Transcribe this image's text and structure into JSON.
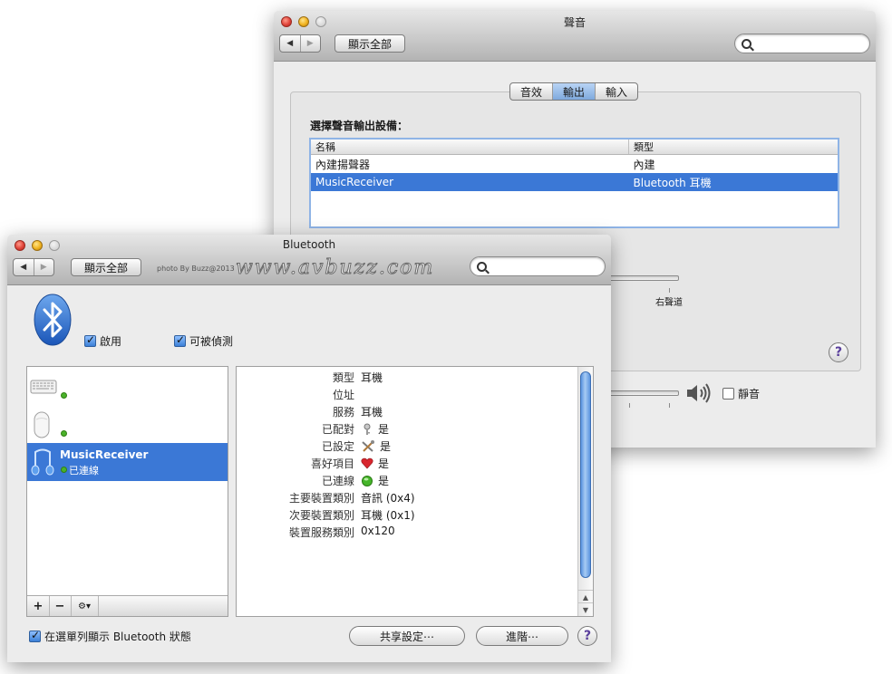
{
  "sound": {
    "title": "聲音",
    "nav_back": "◀",
    "nav_forward": "▶",
    "show_all": "顯示全部",
    "search_placeholder": "",
    "tabs": [
      {
        "label": "音效",
        "selected": false
      },
      {
        "label": "輸出",
        "selected": true
      },
      {
        "label": "輸入",
        "selected": false
      }
    ],
    "choose_label": "選擇聲音輸出設備：",
    "columns": {
      "name": "名稱",
      "type": "類型"
    },
    "devices": [
      {
        "name": "內建揚聲器",
        "type": "內建",
        "selected": false
      },
      {
        "name": "MusicReceiver",
        "type": "Bluetooth 耳機",
        "selected": true
      }
    ],
    "balance_right_label": "右聲道",
    "help": "?",
    "mute_label": "靜音"
  },
  "bluetooth": {
    "title": "Bluetooth",
    "nav_back": "◀",
    "nav_forward": "▶",
    "show_all": "顯示全部",
    "credit": "photo By Buzz@2013",
    "watermark": "www.avbuzz.com",
    "search_placeholder": "",
    "enable_label": "啟用",
    "discoverable_label": "可被偵測",
    "devices": [
      {
        "icon": "keyboard-icon",
        "name": "",
        "status": "",
        "selected": false
      },
      {
        "icon": "mouse-icon",
        "name": "",
        "status": "",
        "selected": false
      },
      {
        "icon": "headphones-icon",
        "name": "MusicReceiver",
        "status": "已連線",
        "selected": true
      }
    ],
    "list_buttons": {
      "add": "+",
      "remove": "−",
      "action": "⚙▾"
    },
    "details": [
      {
        "label": "類型",
        "value": "耳機",
        "icon": ""
      },
      {
        "label": "位址",
        "value": "",
        "icon": ""
      },
      {
        "label": "服務",
        "value": "耳機",
        "icon": ""
      },
      {
        "label": "已配對",
        "value": "是",
        "icon": "key-icon"
      },
      {
        "label": "已設定",
        "value": "是",
        "icon": "tools-icon"
      },
      {
        "label": "喜好項目",
        "value": "是",
        "icon": "heart-icon"
      },
      {
        "label": "已連線",
        "value": "是",
        "icon": "green-light-icon"
      },
      {
        "label": "主要裝置類別",
        "value": "音訊 (0x4)",
        "icon": ""
      },
      {
        "label": "次要裝置類別",
        "value": "耳機 (0x1)",
        "icon": ""
      },
      {
        "label": "裝置服務類別",
        "value": "0x120",
        "icon": ""
      }
    ],
    "show_in_menubar_label": "在選單列顯示 Bluetooth 狀態",
    "sharing_button": "共享設定⋯",
    "advanced_button": "進階⋯",
    "help": "?"
  }
}
